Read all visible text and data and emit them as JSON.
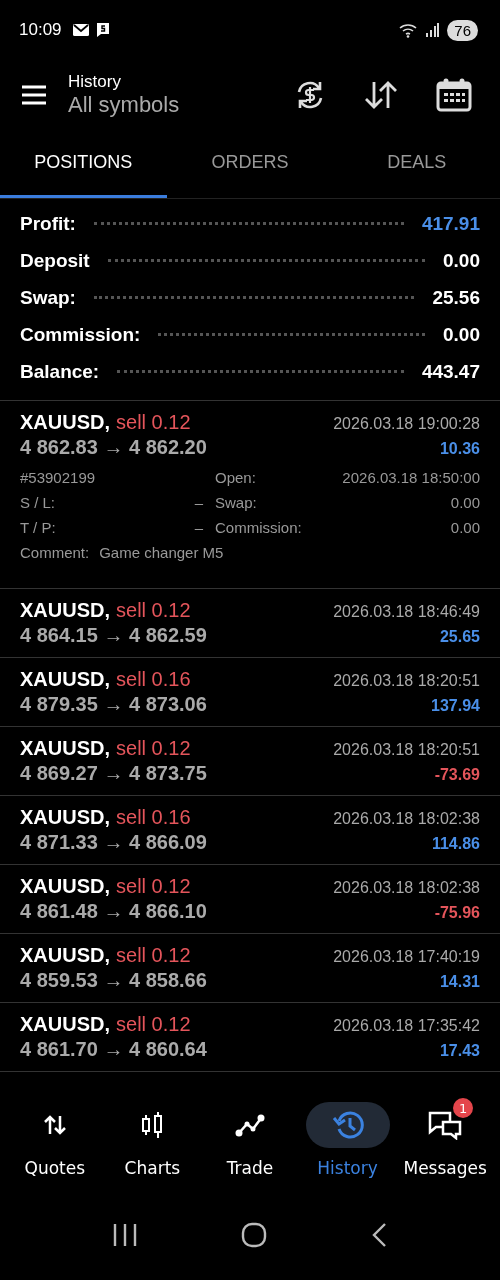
{
  "status_bar": {
    "time": "10:09",
    "battery": "76"
  },
  "header": {
    "title": "History",
    "subtitle": "All symbols"
  },
  "tabs": [
    {
      "label": "POSITIONS",
      "selected": true
    },
    {
      "label": "ORDERS",
      "selected": false
    },
    {
      "label": "DEALS",
      "selected": false
    }
  ],
  "summary": [
    {
      "label": "Profit:",
      "value": "417.91",
      "color": "#4a8fe8"
    },
    {
      "label": "Deposit",
      "value": "0.00",
      "color": "#ffffff"
    },
    {
      "label": "Swap:",
      "value": "25.56",
      "color": "#ffffff"
    },
    {
      "label": "Commission:",
      "value": "0.00",
      "color": "#ffffff"
    },
    {
      "label": "Balance:",
      "value": "443.47",
      "color": "#ffffff"
    }
  ],
  "positions": [
    {
      "symbol": "XAUUSD,",
      "side": "sell 0.12",
      "prices": "4 862.83 → 4 862.20",
      "time": "2026.03.18 19:00:28",
      "profit": "10.36",
      "color": "#4a8fe8",
      "expanded": true,
      "details": {
        "ticket": "#53902199",
        "open_label": "Open:",
        "open_time": "2026.03.18 18:50:00",
        "sl_label": "S / L:",
        "sl": "–",
        "swap_label": "Swap:",
        "swap": "0.00",
        "tp_label": "T / P:",
        "tp": "–",
        "commission_label": "Commission:",
        "commission": "0.00",
        "comment_label": "Comment:",
        "comment": "Game changer M5"
      }
    },
    {
      "symbol": "XAUUSD,",
      "side": "sell 0.12",
      "prices": "4 864.15 → 4 862.59",
      "time": "2026.03.18 18:46:49",
      "profit": "25.65",
      "color": "#4a8fe8",
      "expanded": false
    },
    {
      "symbol": "XAUUSD,",
      "side": "sell 0.16",
      "prices": "4 879.35 → 4 873.06",
      "time": "2026.03.18 18:20:51",
      "profit": "137.94",
      "color": "#4a8fe8",
      "expanded": false
    },
    {
      "symbol": "XAUUSD,",
      "side": "sell 0.12",
      "prices": "4 869.27 → 4 873.75",
      "time": "2026.03.18 18:20:51",
      "profit": "-73.69",
      "color": "#e4555b",
      "expanded": false
    },
    {
      "symbol": "XAUUSD,",
      "side": "sell 0.16",
      "prices": "4 871.33 → 4 866.09",
      "time": "2026.03.18 18:02:38",
      "profit": "114.86",
      "color": "#4a8fe8",
      "expanded": false
    },
    {
      "symbol": "XAUUSD,",
      "side": "sell 0.12",
      "prices": "4 861.48 → 4 866.10",
      "time": "2026.03.18 18:02:38",
      "profit": "-75.96",
      "color": "#e4555b",
      "expanded": false
    },
    {
      "symbol": "XAUUSD,",
      "side": "sell 0.12",
      "prices": "4 859.53 → 4 858.66",
      "time": "2026.03.18 17:40:19",
      "profit": "14.31",
      "color": "#4a8fe8",
      "expanded": false
    },
    {
      "symbol": "XAUUSD,",
      "side": "sell 0.12",
      "prices": "4 861.70 → 4 860.64",
      "time": "2026.03.18 17:35:42",
      "profit": "17.43",
      "color": "#4a8fe8",
      "expanded": false
    }
  ],
  "bottom_nav": [
    {
      "kind": "quotes",
      "label": "Quotes",
      "selected": false
    },
    {
      "kind": "charts",
      "label": "Charts",
      "selected": false
    },
    {
      "kind": "trade",
      "label": "Trade",
      "selected": false
    },
    {
      "kind": "history",
      "label": "History",
      "selected": true
    },
    {
      "kind": "messages",
      "label": "Messages",
      "selected": false,
      "badge": "1"
    }
  ]
}
